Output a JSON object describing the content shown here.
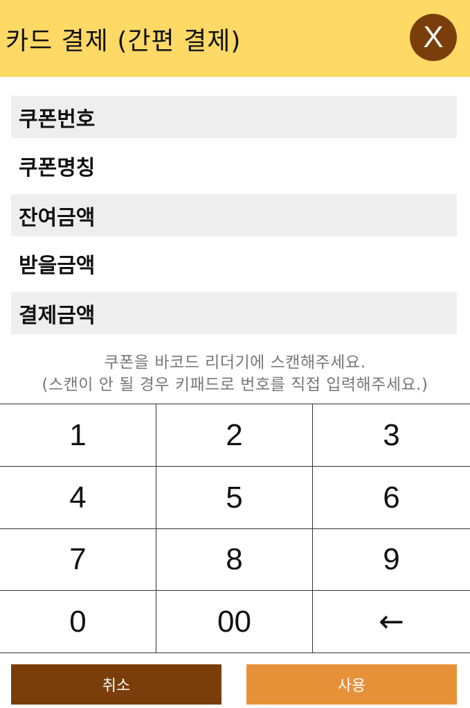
{
  "header": {
    "title": "카드 결제 (간편 결제)",
    "close_label": "X",
    "bg_color": "#FFD966",
    "close_color": "#7A3E0B"
  },
  "fields": [
    {
      "label": "쿠폰번호",
      "shaded": true
    },
    {
      "label": "쿠폰명칭",
      "shaded": false
    },
    {
      "label": "잔여금액",
      "shaded": true
    },
    {
      "label": "받을금액",
      "shaded": false
    },
    {
      "label": "결제금액",
      "shaded": true
    }
  ],
  "notice": {
    "line1": "쿠폰을 바코드 리더기에 스캔해주세요.",
    "line2": "(스캔이 안 될 경우 키패드로 번호를 직접 입력해주세요.)"
  },
  "keypad": {
    "keys": [
      "1",
      "2",
      "3",
      "4",
      "5",
      "6",
      "7",
      "8",
      "9",
      "0",
      "00",
      "←"
    ]
  },
  "buttons": {
    "cancel_label": "취소",
    "use_label": "사용",
    "cancel_color": "#7A3E0B",
    "use_color": "#E69138"
  }
}
